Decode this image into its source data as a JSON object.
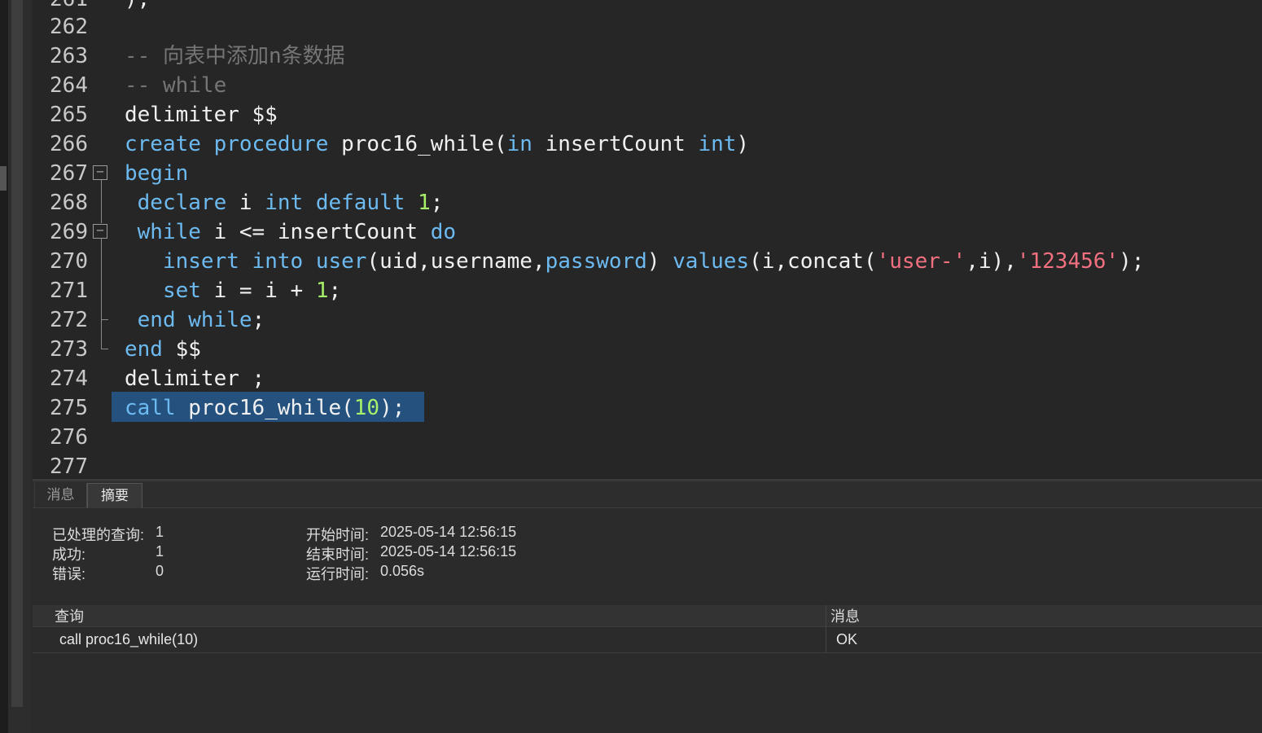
{
  "editor": {
    "lines": [
      {
        "num": "262",
        "tokens": []
      },
      {
        "num": "263",
        "tokens": [
          {
            "t": "-- 向表中添加n条数据",
            "c": "cmt"
          }
        ]
      },
      {
        "num": "264",
        "tokens": [
          {
            "t": "-- while",
            "c": "cmt"
          }
        ]
      },
      {
        "num": "265",
        "tokens": [
          {
            "t": "delimiter $$",
            "c": ""
          }
        ]
      },
      {
        "num": "266",
        "tokens": [
          {
            "t": "create",
            "c": "kw"
          },
          {
            "t": " ",
            "c": ""
          },
          {
            "t": "procedure",
            "c": "kw"
          },
          {
            "t": " proc16_while(",
            "c": ""
          },
          {
            "t": "in",
            "c": "kw"
          },
          {
            "t": " insertCount ",
            "c": ""
          },
          {
            "t": "int",
            "c": "kw"
          },
          {
            "t": ")",
            "c": ""
          }
        ]
      },
      {
        "num": "267",
        "tokens": [
          {
            "t": "begin",
            "c": "kw"
          }
        ]
      },
      {
        "num": "268",
        "tokens": [
          {
            "t": " ",
            "c": ""
          },
          {
            "t": "declare",
            "c": "kw"
          },
          {
            "t": " i ",
            "c": ""
          },
          {
            "t": "int",
            "c": "kw"
          },
          {
            "t": " ",
            "c": ""
          },
          {
            "t": "default",
            "c": "kw"
          },
          {
            "t": " ",
            "c": ""
          },
          {
            "t": "1",
            "c": "num"
          },
          {
            "t": ";",
            "c": ""
          }
        ]
      },
      {
        "num": "269",
        "tokens": [
          {
            "t": " ",
            "c": ""
          },
          {
            "t": "while",
            "c": "kw"
          },
          {
            "t": " i <= insertCount ",
            "c": ""
          },
          {
            "t": "do",
            "c": "kw"
          }
        ]
      },
      {
        "num": "270",
        "tokens": [
          {
            "t": "   ",
            "c": ""
          },
          {
            "t": "insert",
            "c": "kw"
          },
          {
            "t": " ",
            "c": ""
          },
          {
            "t": "into",
            "c": "kw"
          },
          {
            "t": " ",
            "c": ""
          },
          {
            "t": "user",
            "c": "kw"
          },
          {
            "t": "(uid,username,",
            "c": ""
          },
          {
            "t": "password",
            "c": "kw"
          },
          {
            "t": ") ",
            "c": ""
          },
          {
            "t": "values",
            "c": "kw"
          },
          {
            "t": "(i,concat(",
            "c": ""
          },
          {
            "t": "'user-'",
            "c": "str"
          },
          {
            "t": ",i),",
            "c": ""
          },
          {
            "t": "'123456'",
            "c": "str"
          },
          {
            "t": ");",
            "c": ""
          }
        ]
      },
      {
        "num": "271",
        "tokens": [
          {
            "t": "   ",
            "c": ""
          },
          {
            "t": "set",
            "c": "kw"
          },
          {
            "t": " i = i + ",
            "c": ""
          },
          {
            "t": "1",
            "c": "num"
          },
          {
            "t": ";",
            "c": ""
          }
        ]
      },
      {
        "num": "272",
        "tokens": [
          {
            "t": " ",
            "c": ""
          },
          {
            "t": "end",
            "c": "kw"
          },
          {
            "t": " ",
            "c": ""
          },
          {
            "t": "while",
            "c": "kw"
          },
          {
            "t": ";",
            "c": ""
          }
        ]
      },
      {
        "num": "273",
        "tokens": [
          {
            "t": "end",
            "c": "kw"
          },
          {
            "t": " $$",
            "c": ""
          }
        ]
      },
      {
        "num": "274",
        "tokens": [
          {
            "t": "delimiter ;",
            "c": ""
          }
        ]
      },
      {
        "num": "275",
        "tokens": [
          {
            "t": "call",
            "c": "kw"
          },
          {
            "t": " proc16_while(",
            "c": ""
          },
          {
            "t": "10",
            "c": "num"
          },
          {
            "t": ");",
            "c": ""
          }
        ]
      },
      {
        "num": "276",
        "tokens": []
      },
      {
        "num": "277",
        "tokens": []
      }
    ],
    "partial_top_line": {
      "num": "261",
      "text": ");"
    }
  },
  "tabs": {
    "messages": "消息",
    "summary": "摘要"
  },
  "summary": {
    "processed_label": "已处理的查询:",
    "processed_value": "1",
    "success_label": "成功:",
    "success_value": "1",
    "error_label": "错误:",
    "error_value": "0",
    "start_label": "开始时间:",
    "start_value": "2025-05-14 12:56:15",
    "end_label": "结束时间:",
    "end_value": "2025-05-14 12:56:15",
    "run_label": "运行时间:",
    "run_value": "0.056s"
  },
  "results_table": {
    "headers": [
      "查询",
      "消息"
    ],
    "rows": [
      [
        "call proc16_while(10)",
        "OK"
      ]
    ]
  },
  "colors": {
    "keyword": "#6cbaf0",
    "number": "#a8f06a",
    "string": "#f07080",
    "comment": "#757575",
    "selection": "#24517e"
  }
}
